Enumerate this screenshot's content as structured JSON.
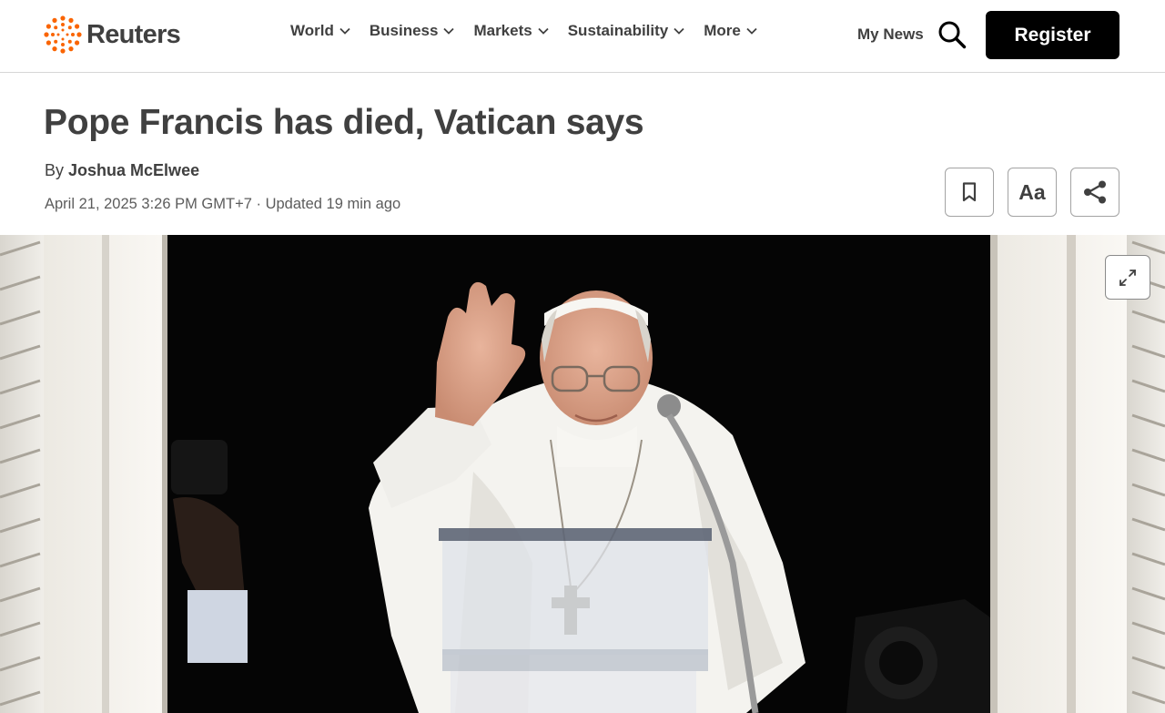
{
  "brand": {
    "name": "Reuters",
    "accent": "#fa6400"
  },
  "nav": {
    "items": [
      {
        "label": "World"
      },
      {
        "label": "Business"
      },
      {
        "label": "Markets"
      },
      {
        "label": "Sustainability"
      },
      {
        "label": "More"
      }
    ],
    "my_news": "My News",
    "search_icon": "search-icon",
    "register": "Register"
  },
  "article": {
    "headline": "Pope Francis has died, Vatican says",
    "byline_prefix": "By",
    "author": "Joshua McElwee",
    "dateline": "April 21, 2025 3:26 PM GMT+7 · Updated 19 min ago"
  },
  "tools": {
    "bookmark_icon": "bookmark-icon",
    "text_size_label": "Aa",
    "share_icon": "share-icon"
  },
  "hero": {
    "expand_icon": "expand-icon"
  }
}
